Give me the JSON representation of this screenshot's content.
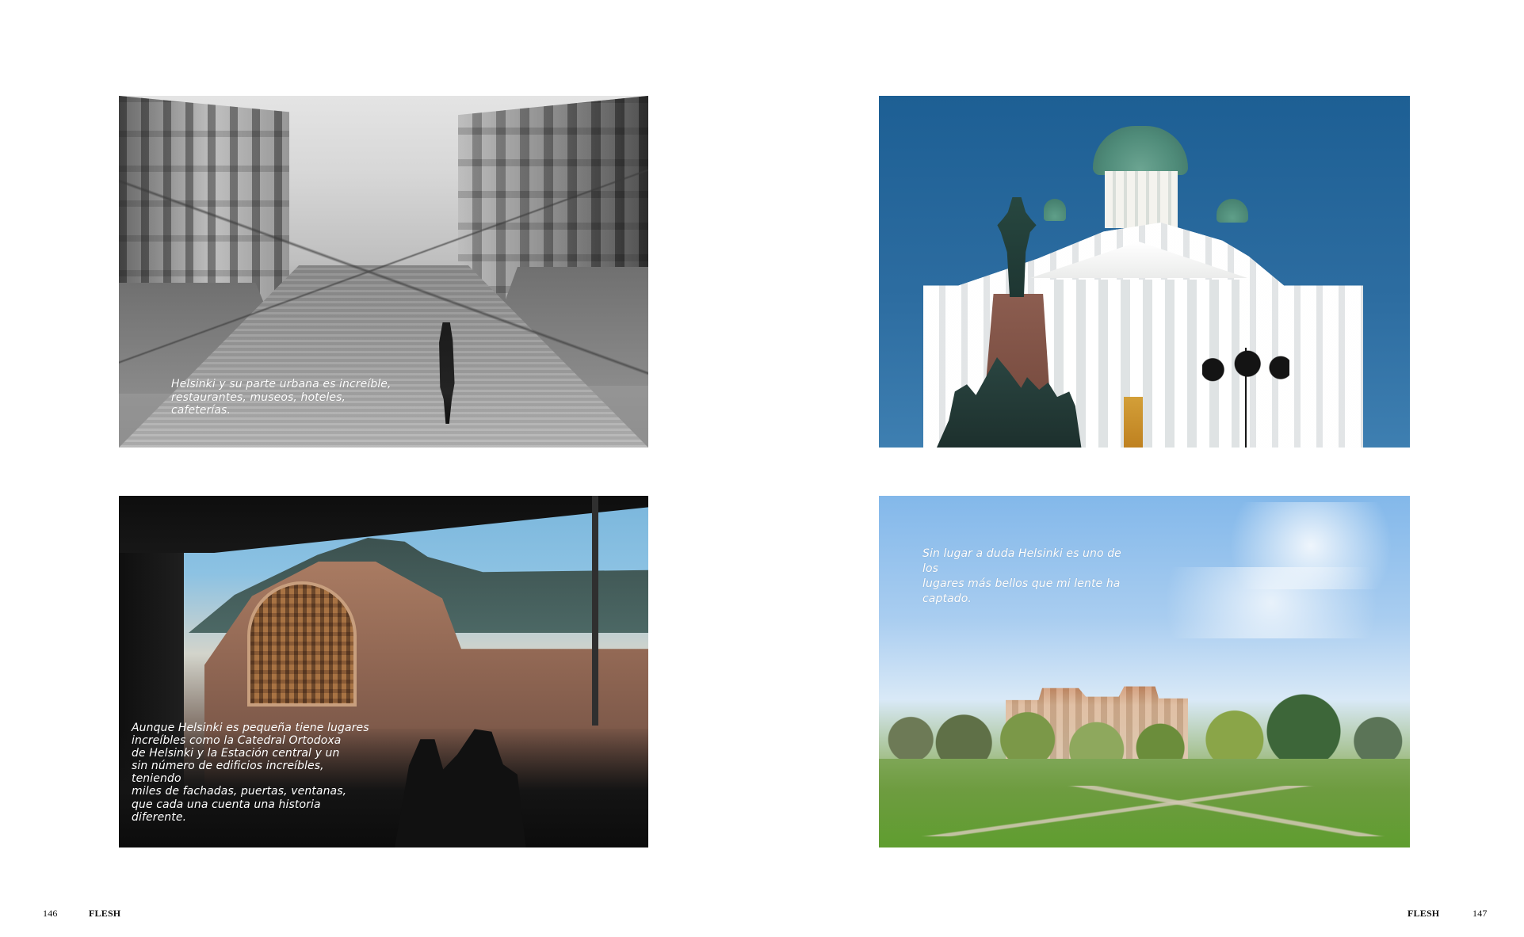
{
  "photos": [
    {
      "caption": "Helsinki y su parte urbana es increíble,\nrestaurantes, museos, hoteles, cafeterías."
    },
    {
      "caption": ""
    },
    {
      "caption": "Aunque Helsinki es pequeña tiene lugares\nincreíbles como la Catedral Ortodoxa\nde Helsinki y la Estación central y un\nsin número de edificios increíbles, teniendo\nmiles de fachadas, puertas, ventanas,\nque cada una cuenta una historia\ndiferente."
    },
    {
      "caption": "Sin lugar a duda Helsinki es uno de los\nlugares más bellos que mi lente ha\ncaptado."
    }
  ],
  "footer": {
    "left_page_number": "146",
    "left_brand": "FLESH",
    "right_brand": "FLESH",
    "right_page_number": "147"
  }
}
